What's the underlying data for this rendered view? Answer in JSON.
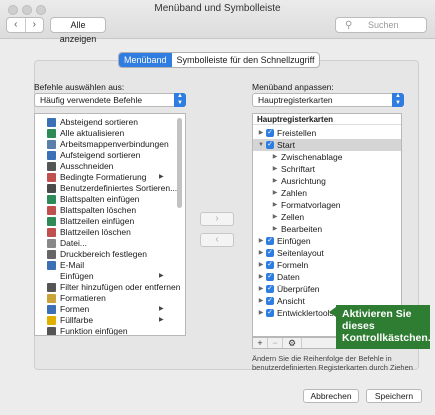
{
  "window": {
    "title": "Menüband und Symbolleiste"
  },
  "toolbar": {
    "back": "‹",
    "forward": "›",
    "show_all": "Alle anzeigen",
    "search_placeholder": "Suchen"
  },
  "tabs": [
    "Menüband",
    "Symbolleiste für den Schnellzugriff"
  ],
  "left": {
    "label": "Befehle auswählen aus:",
    "dropdown": "Häufig verwendete Befehle",
    "items": [
      {
        "label": "Absteigend sortieren",
        "icon": "sort-descending-icon",
        "color": "#3b6fb6"
      },
      {
        "label": "Alle aktualisieren",
        "icon": "refresh-all-icon",
        "color": "#2e8b57"
      },
      {
        "label": "Arbeitsmappenverbindungen",
        "icon": "connections-icon",
        "color": "#5a7fa8"
      },
      {
        "label": "Aufsteigend sortieren",
        "icon": "sort-ascending-icon",
        "color": "#3b6fb6"
      },
      {
        "label": "Ausschneiden",
        "icon": "scissors-icon",
        "color": "#555555"
      },
      {
        "label": "Bedingte Formatierung",
        "icon": "conditional-format-icon",
        "color": "#c0504d",
        "submenu": true
      },
      {
        "label": "Benutzerdefiniertes Sortieren...",
        "icon": "custom-sort-icon",
        "color": "#4a4a4a"
      },
      {
        "label": "Blattspalten einfügen",
        "icon": "insert-columns-icon",
        "color": "#2e8b57"
      },
      {
        "label": "Blattspalten löschen",
        "icon": "delete-columns-icon",
        "color": "#c0504d"
      },
      {
        "label": "Blattzeilen einfügen",
        "icon": "insert-rows-icon",
        "color": "#2e8b57"
      },
      {
        "label": "Blattzeilen löschen",
        "icon": "delete-rows-icon",
        "color": "#c0504d"
      },
      {
        "label": "Datei...",
        "icon": "file-icon",
        "color": "#888888"
      },
      {
        "label": "Druckbereich festlegen",
        "icon": "print-area-icon",
        "color": "#666666"
      },
      {
        "label": "E-Mail",
        "icon": "email-icon",
        "color": "#3b6fb6"
      },
      {
        "label": "Einfügen",
        "icon": "",
        "color": "",
        "submenu": true
      },
      {
        "label": "Filter hinzufügen oder entfernen",
        "icon": "filter-icon",
        "color": "#555555"
      },
      {
        "label": "Formatieren",
        "icon": "format-painter-icon",
        "color": "#caa33a"
      },
      {
        "label": "Formen",
        "icon": "shapes-icon",
        "color": "#3b6fb6",
        "submenu": true
      },
      {
        "label": "Füllfarbe",
        "icon": "fill-color-icon",
        "color": "#e0b000",
        "submenu": true
      },
      {
        "label": "Funktion einfügen",
        "icon": "function-icon",
        "color": "#555555"
      }
    ]
  },
  "right": {
    "label": "Menüband anpassen:",
    "dropdown": "Hauptregisterkarten",
    "header": "Hauptregisterkarten",
    "items": [
      {
        "label": "Freistellen",
        "level": 0,
        "expand": "▶",
        "check": true
      },
      {
        "label": "Start",
        "level": 0,
        "expand": "▼",
        "check": true,
        "selected": true
      },
      {
        "label": "Zwischenablage",
        "level": 1,
        "expand": "▶"
      },
      {
        "label": "Schriftart",
        "level": 1,
        "expand": "▶"
      },
      {
        "label": "Ausrichtung",
        "level": 1,
        "expand": "▶"
      },
      {
        "label": "Zahlen",
        "level": 1,
        "expand": "▶"
      },
      {
        "label": "Formatvorlagen",
        "level": 1,
        "expand": "▶"
      },
      {
        "label": "Zellen",
        "level": 1,
        "expand": "▶"
      },
      {
        "label": "Bearbeiten",
        "level": 1,
        "expand": "▶"
      },
      {
        "label": "Einfügen",
        "level": 0,
        "expand": "▶",
        "check": true
      },
      {
        "label": "Seitenlayout",
        "level": 0,
        "expand": "▶",
        "check": true
      },
      {
        "label": "Formeln",
        "level": 0,
        "expand": "▶",
        "check": true
      },
      {
        "label": "Daten",
        "level": 0,
        "expand": "▶",
        "check": true
      },
      {
        "label": "Überprüfen",
        "level": 0,
        "expand": "▶",
        "check": true
      },
      {
        "label": "Ansicht",
        "level": 0,
        "expand": "▶",
        "check": true
      },
      {
        "label": "Entwicklertools",
        "level": 0,
        "expand": "▶",
        "check": true
      }
    ],
    "add": "+",
    "remove": "−",
    "gear": "⚙",
    "hint": "Ändern Sie die Reihenfolge der Befehle in benutzerdefinierten Registerkarten durch Ziehen"
  },
  "move": {
    "add_arrow": "›",
    "remove_arrow": "‹"
  },
  "callout": "Aktivieren Sie dieses Kontrollkästchen.",
  "footer": {
    "cancel": "Abbrechen",
    "save": "Speichern"
  },
  "colors": {
    "accent": "#2f7de1",
    "callout": "#2e7d32"
  }
}
